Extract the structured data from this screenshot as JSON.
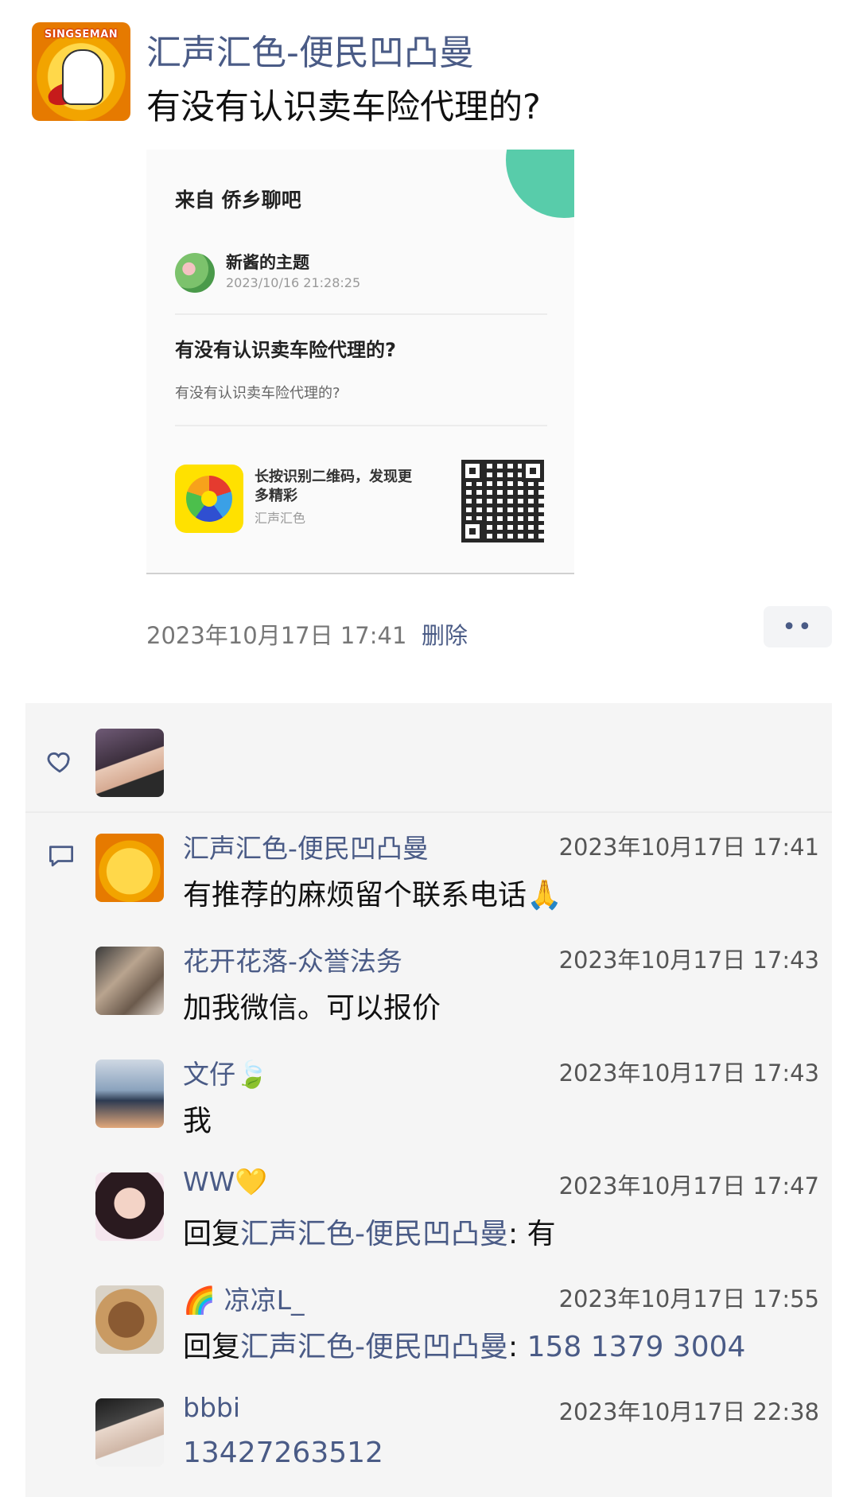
{
  "post": {
    "author": "汇声汇色-便民凹凸曼",
    "avatar_text": "SINGSEMAN",
    "text": "有没有认识卖车险代理的?",
    "time": "2023年10月17日 17:41",
    "delete_label": "删除",
    "more_label": "••"
  },
  "share_card": {
    "source": "来自 侨乡聊吧",
    "author": "新酱的主题",
    "date": "2023/10/16 21:28:25",
    "title": "有没有认识卖车险代理的?",
    "body": "有没有认识卖车险代理的?",
    "qr_hint": "长按识别二维码，发现更多精彩",
    "app_name": "汇声汇色"
  },
  "comments": [
    {
      "name": "汇声汇色-便民凹凸曼",
      "time": "2023年10月17日 17:41",
      "text": "有推荐的麻烦留个联系电话🙏"
    },
    {
      "name": "花开花落-众誉法务",
      "time": "2023年10月17日 17:43",
      "text": "加我微信。可以报价"
    },
    {
      "name": "文仔🍃",
      "time": "2023年10月17日 17:43",
      "text": "我"
    },
    {
      "name": "WW💛",
      "time": "2023年10月17日 17:47",
      "reply_prefix": "回复",
      "reply_target": "汇声汇色-便民凹凸曼",
      "reply_sep": ": ",
      "reply_text": "有"
    },
    {
      "name": "🌈 凉凉L_",
      "time": "2023年10月17日 17:55",
      "reply_prefix": "回复",
      "reply_target": "汇声汇色-便民凹凸曼",
      "reply_sep": ": ",
      "reply_text": "158 1379 3004"
    },
    {
      "name": "bbbi",
      "time": "2023年10月17日 22:38",
      "text": "13427263512"
    }
  ]
}
